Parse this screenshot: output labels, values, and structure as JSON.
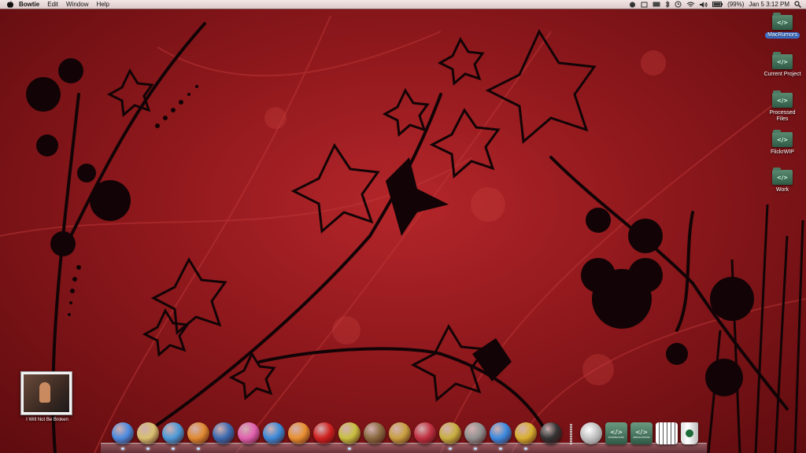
{
  "menubar": {
    "app_name": "Bowtie",
    "items": [
      "Edit",
      "Window",
      "Help"
    ],
    "battery": "(99%)",
    "clock": "Jan 5  3:12 PM"
  },
  "desktop": {
    "icons": [
      {
        "label": "MacRumors",
        "icon": "folder-icon",
        "selected": true
      },
      {
        "label": "Current Project",
        "icon": "folder-icon",
        "selected": false
      },
      {
        "label": "Processed Files",
        "icon": "folder-icon",
        "selected": false
      },
      {
        "label": "FlickrWIP",
        "icon": "folder-icon",
        "selected": false
      },
      {
        "label": "Work",
        "icon": "folder-icon",
        "selected": false
      }
    ]
  },
  "album_widget": {
    "title": "I Will Not Be Broken"
  },
  "dock": {
    "apps": [
      {
        "name": "finder-icon",
        "color": "#4b8be0",
        "running": true
      },
      {
        "name": "itunes-icon",
        "color": "#d8c070",
        "running": true
      },
      {
        "name": "safari-icon",
        "color": "#4a9ad8",
        "running": true
      },
      {
        "name": "photoshop-icon",
        "color": "#e08a30",
        "running": true
      },
      {
        "name": "mail-stamp-icon",
        "color": "#3a6ab0",
        "running": false
      },
      {
        "name": "pink-app-icon",
        "color": "#e060b0",
        "running": false
      },
      {
        "name": "bluebar-app-icon",
        "color": "#3a8ad8",
        "running": false
      },
      {
        "name": "flower-app-icon",
        "color": "#e89030",
        "running": false
      },
      {
        "name": "acrobat-icon",
        "color": "#d02020",
        "running": false
      },
      {
        "name": "ball-app-icon",
        "color": "#c8c040",
        "running": true
      },
      {
        "name": "notepad-icon",
        "color": "#8a6a40",
        "running": false
      },
      {
        "name": "pencil-app-icon",
        "color": "#c8a040",
        "running": false
      },
      {
        "name": "bug-app-icon",
        "color": "#c03040",
        "running": false
      },
      {
        "name": "lock-app-icon",
        "color": "#c8b040",
        "running": true
      },
      {
        "name": "speaker-app-icon",
        "color": "#909090",
        "running": true
      },
      {
        "name": "blue-app-icon",
        "color": "#3a8ae0",
        "running": true
      },
      {
        "name": "folder-yellow-icon",
        "color": "#d8b030",
        "running": true
      },
      {
        "name": "camera-app-icon",
        "color": "#333333",
        "running": false
      }
    ],
    "stacks": [
      {
        "name": "downloads-stack-icon",
        "caption": "DOWNLOADS"
      },
      {
        "name": "applications-stack-icon",
        "caption": "APPLICATIONS"
      }
    ],
    "extras": [
      {
        "name": "spring-app-icon"
      },
      {
        "name": "calendar-grid-icon"
      },
      {
        "name": "trash-icon"
      }
    ]
  }
}
